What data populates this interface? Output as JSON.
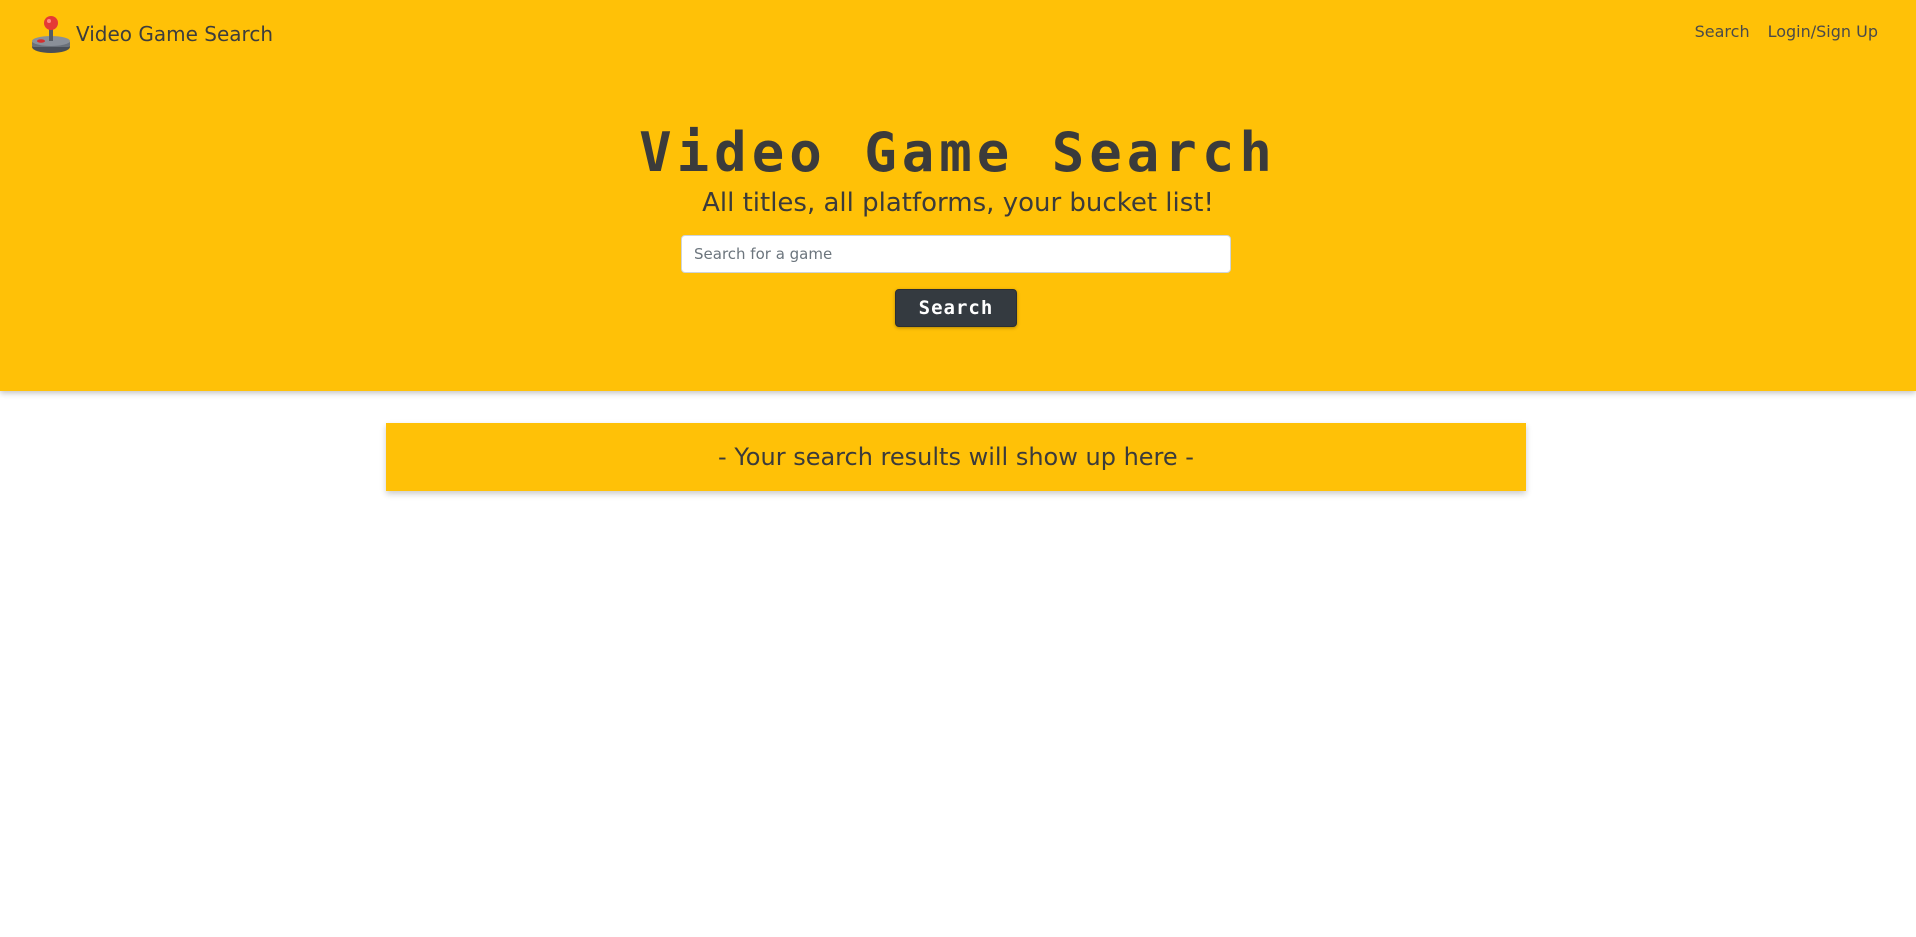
{
  "navbar": {
    "brand_icon": "joystick-icon",
    "brand_text": "Video Game Search",
    "links": [
      "Search",
      "Login/Sign Up"
    ]
  },
  "hero": {
    "title": "Video Game Search",
    "subtitle": "All titles, all platforms, your bucket list!",
    "search": {
      "placeholder": "Search for a game",
      "value": ""
    },
    "search_button_label": "Search"
  },
  "results": {
    "message": "- Your search results will show up here -"
  },
  "colors": {
    "accent": "#ffc107",
    "dark": "#343a40",
    "text": "#3b3b3b"
  }
}
